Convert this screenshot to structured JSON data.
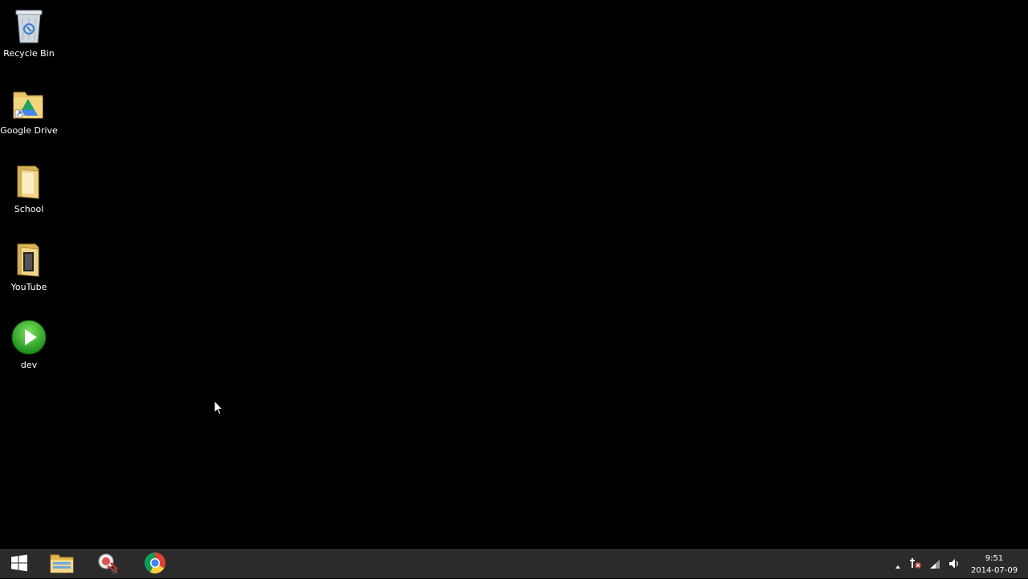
{
  "desktop": {
    "background_color": "#000000",
    "icons": [
      {
        "label": "Recycle Bin",
        "icon": "recycle-bin-icon"
      },
      {
        "label": "Google Drive",
        "icon": "google-drive-folder-icon"
      },
      {
        "label": "School",
        "icon": "folder-icon"
      },
      {
        "label": "YouTube",
        "icon": "folder-icon"
      },
      {
        "label": "dev",
        "icon": "green-play-icon"
      }
    ]
  },
  "taskbar": {
    "background_color": "#2b2b2b",
    "start": {
      "icon": "windows-logo-icon"
    },
    "pinned": [
      {
        "icon": "file-explorer-icon"
      },
      {
        "icon": "snipping-tool-icon"
      },
      {
        "icon": "chrome-icon"
      }
    ],
    "tray": {
      "icons": [
        "show-hidden-icons-chevron",
        "network-error-icon",
        "wifi-signal-icon",
        "volume-icon"
      ],
      "time": "9:51",
      "date": "2014-07-09"
    }
  }
}
